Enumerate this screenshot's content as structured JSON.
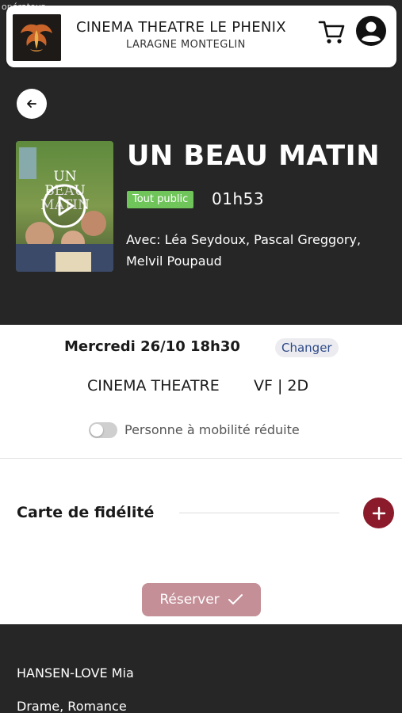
{
  "status_bar": {
    "carrier": "opérateur"
  },
  "header": {
    "cinema_name": "CINEMA THEATRE LE PHENIX",
    "city": "LARAGNE MONTEGLIN",
    "cart_icon": "cart-icon",
    "account_icon": "account-icon"
  },
  "movie": {
    "title": "UN BEAU MATIN",
    "rating": "Tout public",
    "duration": "01h53",
    "cast": "Avec: Léa Seydoux, Pascal Greggory, Melvil Poupaud",
    "poster_title_lines": [
      "UN",
      "BEAU",
      "MATIN"
    ]
  },
  "session": {
    "date": "Mercredi 26/10 18h30",
    "change_label": "Changer",
    "room": "CINEMA THEATRE",
    "version": "VF | 2D",
    "pmr_label": "Personne à mobilité réduite",
    "pmr_enabled": false
  },
  "loyalty": {
    "label": "Carte de fidélité"
  },
  "reserve": {
    "label": "Réserver"
  },
  "footer": {
    "director": "HANSEN-LOVE Mia",
    "genre": "Drame, Romance"
  },
  "colors": {
    "dark_bg": "#262626",
    "accent": "#8b1a2b",
    "reserve_button": "#c48f97",
    "rating_badge": "#6fc45a",
    "change_text": "#2e4a8a"
  }
}
